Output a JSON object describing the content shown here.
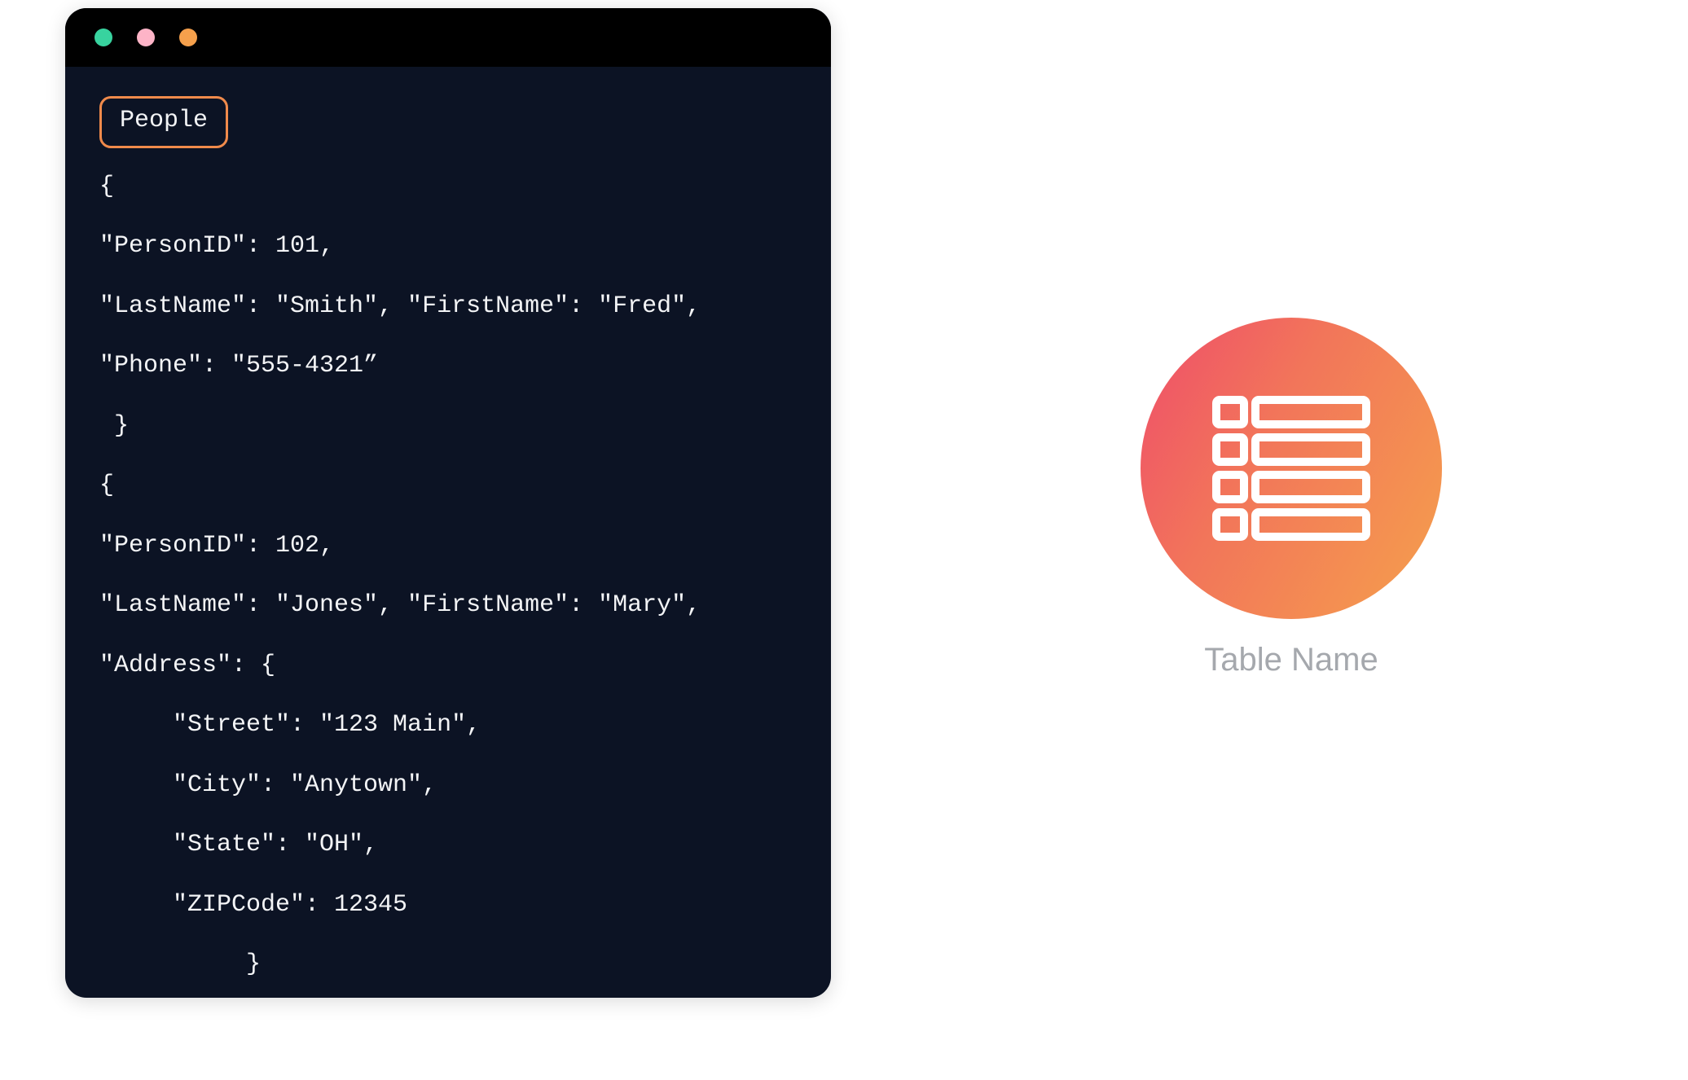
{
  "code_window": {
    "table_name": "People",
    "lines": [
      "{",
      "\"PersonID\": 101,",
      "\"LastName\": \"Smith\", \"FirstName\": \"Fred\",",
      "\"Phone\": \"555-4321”",
      " }",
      "{",
      "\"PersonID\": 102,",
      "\"LastName\": \"Jones\", \"FirstName\": \"Mary\",",
      "\"Address\": {",
      "     \"Street\": \"123 Main\",",
      "     \"City\": \"Anytown\",",
      "     \"State\": \"OH\",",
      "     \"ZIPCode\": 12345",
      "          }",
      "}"
    ]
  },
  "legend": {
    "label": "Table Name"
  },
  "people": [
    {
      "PersonID": 101,
      "LastName": "Smith",
      "FirstName": "Fred",
      "Phone": "555-4321"
    },
    {
      "PersonID": 102,
      "LastName": "Jones",
      "FirstName": "Mary",
      "Address": {
        "Street": "123 Main",
        "City": "Anytown",
        "State": "OH",
        "ZIPCode": 12345
      }
    }
  ]
}
